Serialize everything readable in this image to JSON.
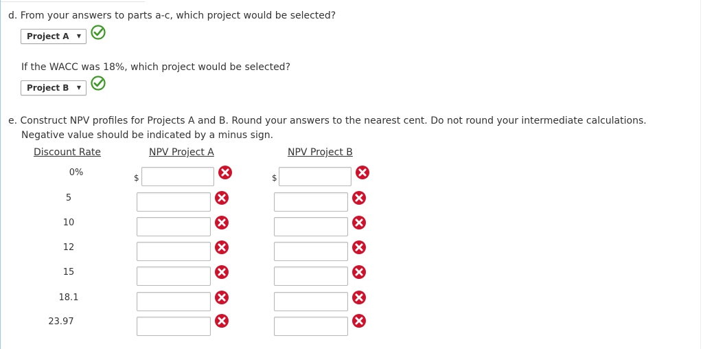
{
  "part_d": {
    "question": "d. From your answers to parts a-c, which project would be selected?",
    "selection": "Project A",
    "followup_question": "If the WACC was 18%, which project would be selected?",
    "followup_selection": "Project B"
  },
  "part_e": {
    "instruction_line1": "e. Construct NPV profiles for Projects A and B. Round your answers to the nearest cent. Do not round your intermediate calculations.",
    "instruction_line2": "Negative value should be indicated by a minus sign.",
    "headers": {
      "discount_rate": "Discount Rate",
      "npv_a": "NPV Project A",
      "npv_b": "NPV Project B"
    },
    "currency_symbol": "$",
    "rows": [
      {
        "rate": "0%",
        "npv_a": "",
        "npv_b": ""
      },
      {
        "rate": "5",
        "npv_a": "",
        "npv_b": ""
      },
      {
        "rate": "10",
        "npv_a": "",
        "npv_b": ""
      },
      {
        "rate": "12",
        "npv_a": "",
        "npv_b": ""
      },
      {
        "rate": "15",
        "npv_a": "",
        "npv_b": ""
      },
      {
        "rate": "18.1",
        "npv_a": "",
        "npv_b": ""
      },
      {
        "rate": "23.97",
        "npv_a": "",
        "npv_b": ""
      }
    ]
  },
  "icons": {
    "correct": "check-circle-icon",
    "incorrect": "x-circle-icon"
  },
  "colors": {
    "correct": "#3a9a22",
    "incorrect": "#d0112b",
    "border_accent": "#9fc7ec"
  }
}
